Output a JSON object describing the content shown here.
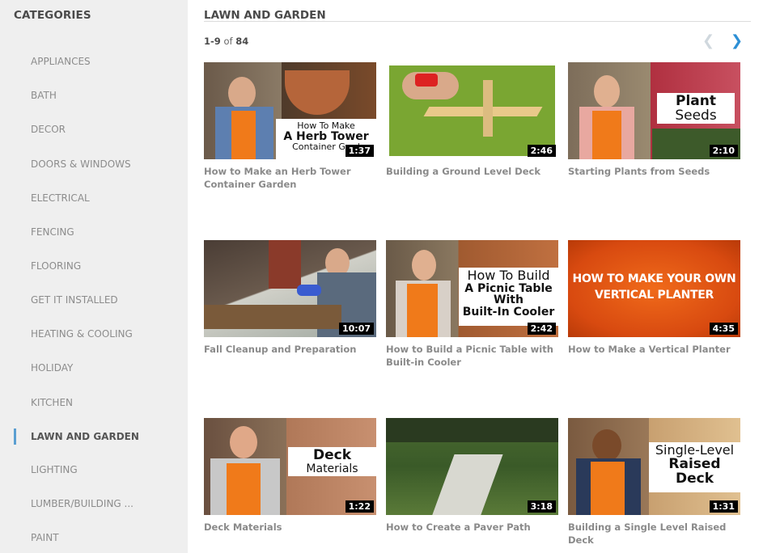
{
  "sidebar": {
    "title": "CATEGORIES",
    "items": [
      {
        "label": "APPLIANCES"
      },
      {
        "label": "BATH"
      },
      {
        "label": "DECOR"
      },
      {
        "label": "DOORS & WINDOWS"
      },
      {
        "label": "ELECTRICAL"
      },
      {
        "label": "FENCING"
      },
      {
        "label": "FLOORING"
      },
      {
        "label": "GET IT INSTALLED"
      },
      {
        "label": "HEATING & COOLING"
      },
      {
        "label": "HOLIDAY"
      },
      {
        "label": "KITCHEN"
      },
      {
        "label": "LAWN AND GARDEN"
      },
      {
        "label": "LIGHTING"
      },
      {
        "label": "LUMBER/BUILDING ..."
      },
      {
        "label": "PAINT"
      }
    ],
    "active": "LAWN AND GARDEN"
  },
  "main": {
    "title": "LAWN AND GARDEN",
    "range": "1-9",
    "of_label": "of",
    "total": "84",
    "prev_icon": "chevron-left-icon",
    "next_icon": "chevron-right-icon"
  },
  "videos": [
    {
      "title": "How to Make an Herb Tower Container Garden",
      "duration": "1:37",
      "overlay": [
        "How To Make",
        "A Herb Tower",
        "Container Gard"
      ]
    },
    {
      "title": "Building a Ground Level Deck",
      "duration": "2:46"
    },
    {
      "title": "Starting Plants from Seeds",
      "duration": "2:10",
      "overlay": [
        "Plant",
        "Seeds"
      ]
    },
    {
      "title": "Fall Cleanup and Preparation",
      "duration": "10:07"
    },
    {
      "title": "How to Build a Picnic Table with Built-in Cooler",
      "duration": "2:42",
      "overlay": [
        "How To Build",
        "A Picnic Table",
        "With",
        "Built-In Cooler"
      ]
    },
    {
      "title": "How to Make a Vertical Planter",
      "duration": "4:35",
      "overlay": [
        "HOW TO MAKE YOUR OWN",
        "VERTICAL PLANTER"
      ]
    },
    {
      "title": "Deck Materials",
      "duration": "1:22",
      "overlay": [
        "Deck",
        "Materials"
      ]
    },
    {
      "title": "How to Create a Paver Path",
      "duration": "3:18"
    },
    {
      "title": "Building a Single Level Raised Deck",
      "duration": "1:31",
      "overlay": [
        "Single-Level",
        "Raised",
        "Deck"
      ]
    }
  ]
}
